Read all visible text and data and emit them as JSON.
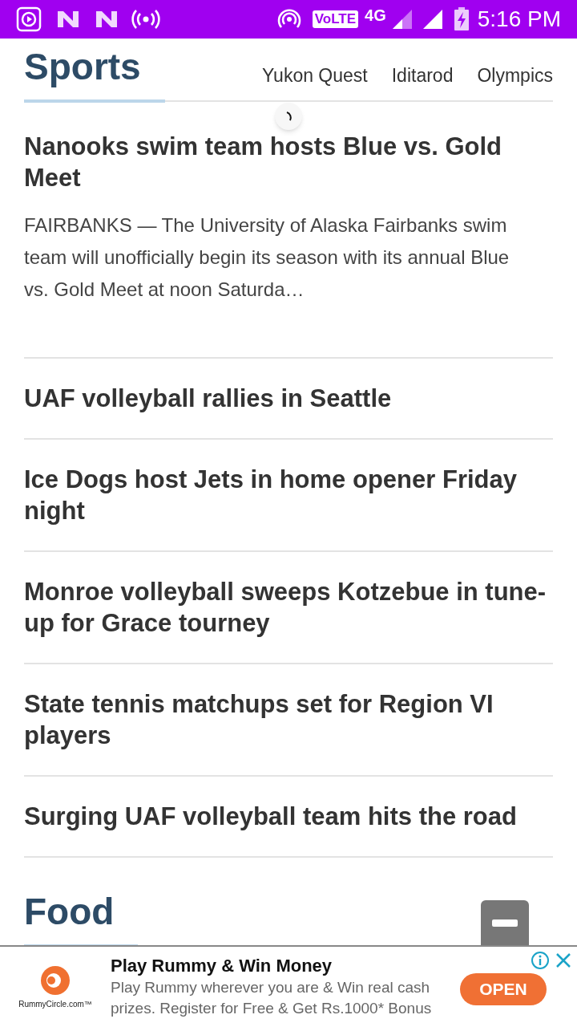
{
  "status_bar": {
    "volte": "VoLTE",
    "network": "4G",
    "time": "5:16 PM"
  },
  "sections": [
    {
      "title": "Sports",
      "links": [
        "Yukon Quest",
        "Iditarod",
        "Olympics"
      ],
      "articles": [
        {
          "title": "Nanooks swim team hosts Blue vs. Gold Meet",
          "snippet": "FAIRBANKS — The University of Alaska Fairbanks swim team will unofficially begin its season with its annual Blue vs. Gold Meet at noon Saturda…"
        },
        {
          "title": "UAF volleyball rallies in Seattle"
        },
        {
          "title": "Ice Dogs host Jets in home opener Friday night"
        },
        {
          "title": "Monroe volleyball sweeps Kotzebue in tune-up for Grace tourney"
        },
        {
          "title": "State tennis matchups set for Region VI players"
        },
        {
          "title": "Surging UAF volleyball team hits the road"
        }
      ]
    },
    {
      "title": "Food"
    }
  ],
  "ad": {
    "brand": "RummyCircle.com™",
    "headline": "Play Rummy & Win Money",
    "body": "Play Rummy wherever you are & Win real cash prizes. Register for Free & Get Rs.1000* Bonus",
    "button": "OPEN"
  }
}
